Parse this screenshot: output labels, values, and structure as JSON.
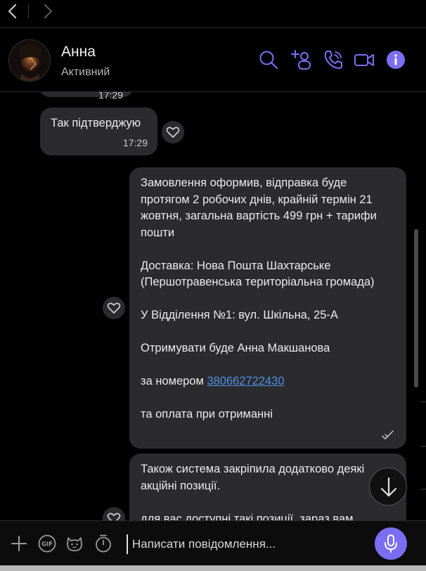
{
  "colors": {
    "accent": "#7b6ef2",
    "bubble": "#2b2b2e",
    "link": "#4f8fe6",
    "background": "#000000"
  },
  "topnav": {
    "back_icon": "chevron-left-icon",
    "forward_icon": "chevron-right-icon"
  },
  "header": {
    "name": "Анна",
    "status": "Активний",
    "icons": [
      "search-icon",
      "add-participant-icon",
      "phone-icon",
      "video-icon",
      "info-icon"
    ]
  },
  "messages": [
    {
      "id": "partial",
      "time": "17:29"
    },
    {
      "id": "confirm",
      "text": "Так підтверджую",
      "time": "17:29"
    },
    {
      "id": "order",
      "lines": [
        "Замовлення оформив, відправка буде",
        "протягом 2 робочих днів, крайній термін 21",
        "жовтня, загальна вартість 499 грн + тарифи",
        "пошти",
        "",
        "Доставка: Нова Пошта  Шахтарське",
        "(Першотравенська територіальна громада)",
        "",
        "У Відділення №1: вул. Шкільна, 25-А",
        "",
        "Отримувати буде Анна Макшанова",
        ""
      ],
      "phone_prefix": "за номером ",
      "phone": "380662722430",
      "closing": "та оплата при отриманні"
    },
    {
      "id": "promo",
      "lines": [
        "Також система закріпила додатково деякі",
        "акційні позиції.",
        "",
        "для вас доступні такі позиції, зараз вам"
      ]
    }
  ],
  "composer": {
    "placeholder": "Написати повідомлення...",
    "icons": [
      "plus-icon",
      "gif-icon",
      "sticker-icon",
      "timer-icon",
      "microphone-icon"
    ]
  }
}
